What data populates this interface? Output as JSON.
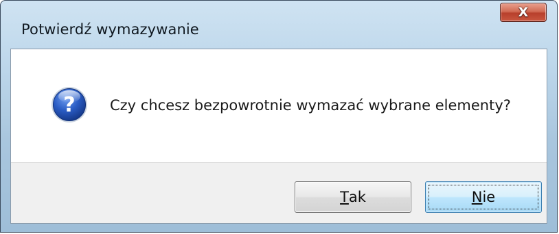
{
  "window": {
    "title": "Potwierdź wymazywanie",
    "close_label": "X"
  },
  "dialog": {
    "icon": "question-icon",
    "message": "Czy chcesz bezpowrotnie wymazać wybrane elementy?"
  },
  "buttons": {
    "yes": {
      "accel": "T",
      "rest": "ak"
    },
    "no": {
      "accel": "N",
      "rest": "ie"
    }
  },
  "colors": {
    "icon_blue": "#1e4fb0",
    "close_red": "#c8563f",
    "default_button_border": "#3c7fb1"
  }
}
